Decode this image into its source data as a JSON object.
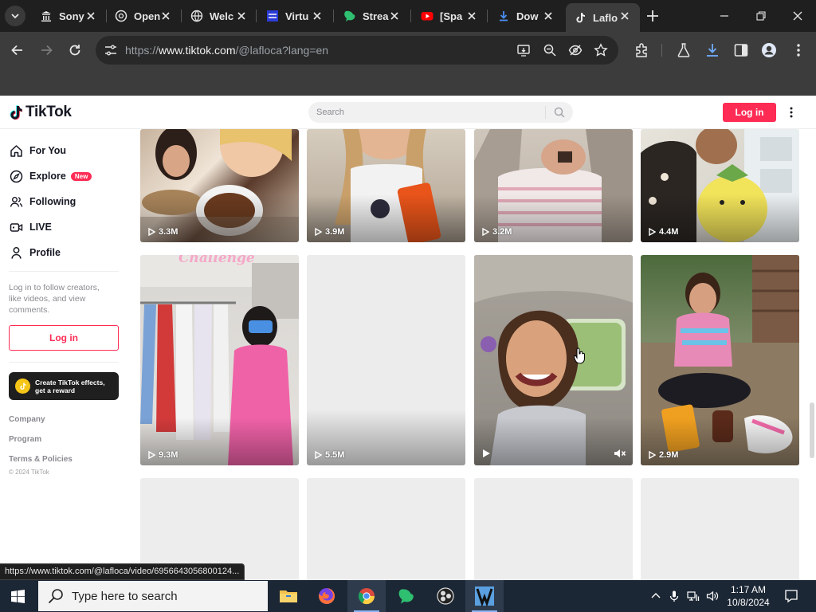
{
  "browser": {
    "tabs": [
      {
        "title": "Sony",
        "icon": "museum-icon"
      },
      {
        "title": "Open",
        "icon": "openai-icon"
      },
      {
        "title": "Welc",
        "icon": "globe-icon"
      },
      {
        "title": "Virtu",
        "icon": "virtual-icon"
      },
      {
        "title": "Strea",
        "icon": "stream-icon"
      },
      {
        "title": "[Spa",
        "icon": "youtube-icon"
      },
      {
        "title": "Dow",
        "icon": "download-icon"
      },
      {
        "title": "Laflo",
        "icon": "tiktok-icon",
        "active": true
      }
    ],
    "url_prefix": "https://",
    "url_host": "www.tiktok.com",
    "url_path": "/@lafloca?lang=en"
  },
  "header": {
    "logo": "TikTok",
    "search_placeholder": "Search",
    "login_label": "Log in"
  },
  "sidebar": {
    "nav": [
      {
        "label": "For You",
        "icon": "home-icon"
      },
      {
        "label": "Explore",
        "icon": "compass-icon",
        "badge": "New"
      },
      {
        "label": "Following",
        "icon": "users-icon"
      },
      {
        "label": "LIVE",
        "icon": "live-icon"
      },
      {
        "label": "Profile",
        "icon": "person-icon"
      }
    ],
    "hint": "Log in to follow creators, like videos, and view comments.",
    "login_label": "Log in",
    "effects_line1": "Create TikTok effects,",
    "effects_line2": "get a reward",
    "links": [
      "Company",
      "Program",
      "Terms & Policies"
    ],
    "copyright": "© 2024 TikTok"
  },
  "videos": {
    "row1": [
      "3.3M",
      "3.9M",
      "3.2M",
      "4.4M"
    ],
    "row2": [
      "9.3M",
      "5.5M",
      "",
      "2.9M"
    ],
    "challenge_text": "Challenge"
  },
  "status_url": "https://www.tiktok.com/@lafloca/video/6956643056800124...",
  "taskbar": {
    "search_placeholder": "Type here to search",
    "time": "1:17 AM",
    "date": "10/8/2024"
  },
  "colors": {
    "brand": "#fe2c55",
    "chrome_dark": "#1f1f1f",
    "taskbar": "#1c2735"
  }
}
